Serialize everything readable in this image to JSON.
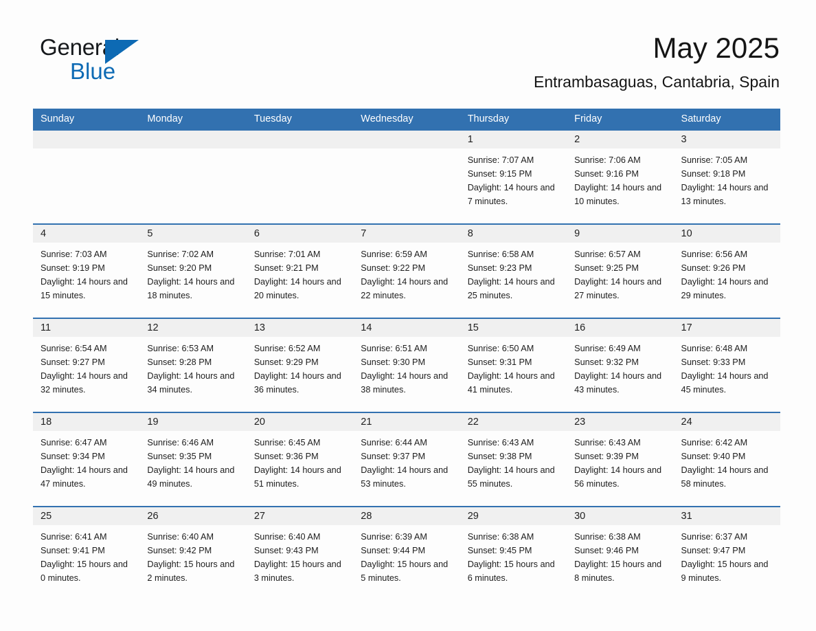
{
  "brand": {
    "name_part1": "General",
    "name_part2": "Blue",
    "accent_color": "#0d6ab4"
  },
  "header": {
    "title": "May 2025",
    "subtitle": "Entrambasaguas, Cantabria, Spain"
  },
  "calendar": {
    "header_bg": "#3271b0",
    "day_band_bg": "#f0f0f0",
    "day_names": [
      "Sunday",
      "Monday",
      "Tuesday",
      "Wednesday",
      "Thursday",
      "Friday",
      "Saturday"
    ],
    "weeks": [
      [
        {
          "day": "",
          "empty": true
        },
        {
          "day": "",
          "empty": true
        },
        {
          "day": "",
          "empty": true
        },
        {
          "day": "",
          "empty": true
        },
        {
          "day": "1",
          "sunrise": "Sunrise: 7:07 AM",
          "sunset": "Sunset: 9:15 PM",
          "daylight": "Daylight: 14 hours and 7 minutes."
        },
        {
          "day": "2",
          "sunrise": "Sunrise: 7:06 AM",
          "sunset": "Sunset: 9:16 PM",
          "daylight": "Daylight: 14 hours and 10 minutes."
        },
        {
          "day": "3",
          "sunrise": "Sunrise: 7:05 AM",
          "sunset": "Sunset: 9:18 PM",
          "daylight": "Daylight: 14 hours and 13 minutes."
        }
      ],
      [
        {
          "day": "4",
          "sunrise": "Sunrise: 7:03 AM",
          "sunset": "Sunset: 9:19 PM",
          "daylight": "Daylight: 14 hours and 15 minutes."
        },
        {
          "day": "5",
          "sunrise": "Sunrise: 7:02 AM",
          "sunset": "Sunset: 9:20 PM",
          "daylight": "Daylight: 14 hours and 18 minutes."
        },
        {
          "day": "6",
          "sunrise": "Sunrise: 7:01 AM",
          "sunset": "Sunset: 9:21 PM",
          "daylight": "Daylight: 14 hours and 20 minutes."
        },
        {
          "day": "7",
          "sunrise": "Sunrise: 6:59 AM",
          "sunset": "Sunset: 9:22 PM",
          "daylight": "Daylight: 14 hours and 22 minutes."
        },
        {
          "day": "8",
          "sunrise": "Sunrise: 6:58 AM",
          "sunset": "Sunset: 9:23 PM",
          "daylight": "Daylight: 14 hours and 25 minutes."
        },
        {
          "day": "9",
          "sunrise": "Sunrise: 6:57 AM",
          "sunset": "Sunset: 9:25 PM",
          "daylight": "Daylight: 14 hours and 27 minutes."
        },
        {
          "day": "10",
          "sunrise": "Sunrise: 6:56 AM",
          "sunset": "Sunset: 9:26 PM",
          "daylight": "Daylight: 14 hours and 29 minutes."
        }
      ],
      [
        {
          "day": "11",
          "sunrise": "Sunrise: 6:54 AM",
          "sunset": "Sunset: 9:27 PM",
          "daylight": "Daylight: 14 hours and 32 minutes."
        },
        {
          "day": "12",
          "sunrise": "Sunrise: 6:53 AM",
          "sunset": "Sunset: 9:28 PM",
          "daylight": "Daylight: 14 hours and 34 minutes."
        },
        {
          "day": "13",
          "sunrise": "Sunrise: 6:52 AM",
          "sunset": "Sunset: 9:29 PM",
          "daylight": "Daylight: 14 hours and 36 minutes."
        },
        {
          "day": "14",
          "sunrise": "Sunrise: 6:51 AM",
          "sunset": "Sunset: 9:30 PM",
          "daylight": "Daylight: 14 hours and 38 minutes."
        },
        {
          "day": "15",
          "sunrise": "Sunrise: 6:50 AM",
          "sunset": "Sunset: 9:31 PM",
          "daylight": "Daylight: 14 hours and 41 minutes."
        },
        {
          "day": "16",
          "sunrise": "Sunrise: 6:49 AM",
          "sunset": "Sunset: 9:32 PM",
          "daylight": "Daylight: 14 hours and 43 minutes."
        },
        {
          "day": "17",
          "sunrise": "Sunrise: 6:48 AM",
          "sunset": "Sunset: 9:33 PM",
          "daylight": "Daylight: 14 hours and 45 minutes."
        }
      ],
      [
        {
          "day": "18",
          "sunrise": "Sunrise: 6:47 AM",
          "sunset": "Sunset: 9:34 PM",
          "daylight": "Daylight: 14 hours and 47 minutes."
        },
        {
          "day": "19",
          "sunrise": "Sunrise: 6:46 AM",
          "sunset": "Sunset: 9:35 PM",
          "daylight": "Daylight: 14 hours and 49 minutes."
        },
        {
          "day": "20",
          "sunrise": "Sunrise: 6:45 AM",
          "sunset": "Sunset: 9:36 PM",
          "daylight": "Daylight: 14 hours and 51 minutes."
        },
        {
          "day": "21",
          "sunrise": "Sunrise: 6:44 AM",
          "sunset": "Sunset: 9:37 PM",
          "daylight": "Daylight: 14 hours and 53 minutes."
        },
        {
          "day": "22",
          "sunrise": "Sunrise: 6:43 AM",
          "sunset": "Sunset: 9:38 PM",
          "daylight": "Daylight: 14 hours and 55 minutes."
        },
        {
          "day": "23",
          "sunrise": "Sunrise: 6:43 AM",
          "sunset": "Sunset: 9:39 PM",
          "daylight": "Daylight: 14 hours and 56 minutes."
        },
        {
          "day": "24",
          "sunrise": "Sunrise: 6:42 AM",
          "sunset": "Sunset: 9:40 PM",
          "daylight": "Daylight: 14 hours and 58 minutes."
        }
      ],
      [
        {
          "day": "25",
          "sunrise": "Sunrise: 6:41 AM",
          "sunset": "Sunset: 9:41 PM",
          "daylight": "Daylight: 15 hours and 0 minutes."
        },
        {
          "day": "26",
          "sunrise": "Sunrise: 6:40 AM",
          "sunset": "Sunset: 9:42 PM",
          "daylight": "Daylight: 15 hours and 2 minutes."
        },
        {
          "day": "27",
          "sunrise": "Sunrise: 6:40 AM",
          "sunset": "Sunset: 9:43 PM",
          "daylight": "Daylight: 15 hours and 3 minutes."
        },
        {
          "day": "28",
          "sunrise": "Sunrise: 6:39 AM",
          "sunset": "Sunset: 9:44 PM",
          "daylight": "Daylight: 15 hours and 5 minutes."
        },
        {
          "day": "29",
          "sunrise": "Sunrise: 6:38 AM",
          "sunset": "Sunset: 9:45 PM",
          "daylight": "Daylight: 15 hours and 6 minutes."
        },
        {
          "day": "30",
          "sunrise": "Sunrise: 6:38 AM",
          "sunset": "Sunset: 9:46 PM",
          "daylight": "Daylight: 15 hours and 8 minutes."
        },
        {
          "day": "31",
          "sunrise": "Sunrise: 6:37 AM",
          "sunset": "Sunset: 9:47 PM",
          "daylight": "Daylight: 15 hours and 9 minutes."
        }
      ]
    ]
  }
}
